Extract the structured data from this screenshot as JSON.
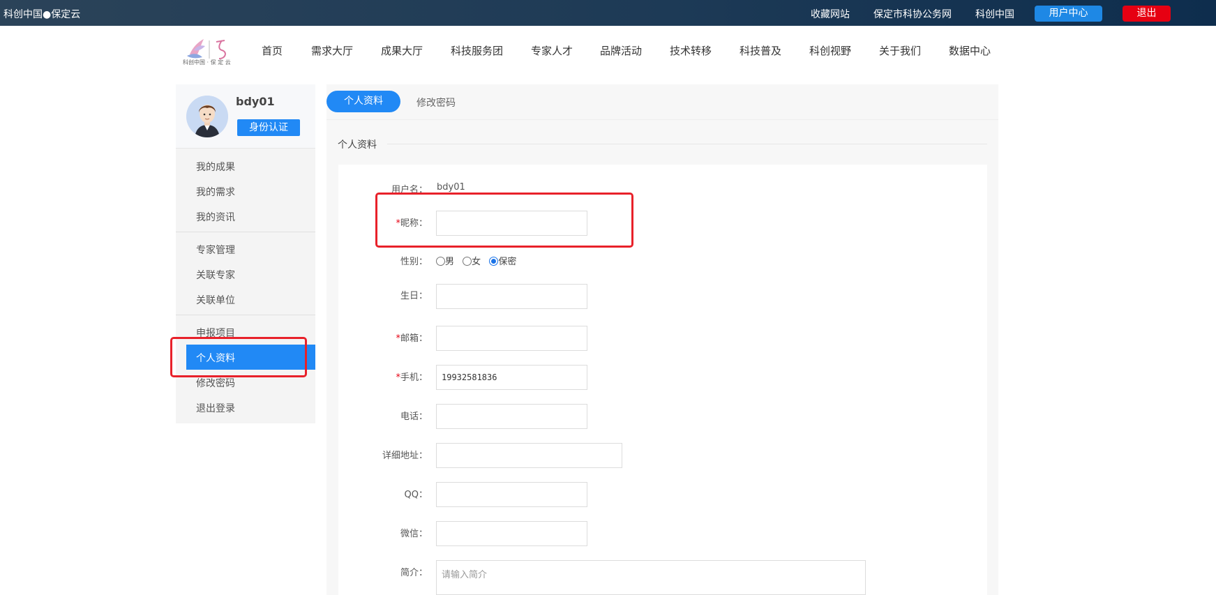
{
  "topbar": {
    "site_name": "科创中国●保定云",
    "links": [
      "收藏网站",
      "保定市科协公务网",
      "科创中国"
    ],
    "user_center": "用户中心",
    "logout": "退出"
  },
  "logo": {
    "caption": "科创中国 · 保 定 云"
  },
  "nav": [
    "首页",
    "需求大厅",
    "成果大厅",
    "科技服务团",
    "专家人才",
    "品牌活动",
    "技术转移",
    "科技普及",
    "科创视野",
    "关于我们",
    "数据中心"
  ],
  "sidebar": {
    "username": "bdy01",
    "verify_button": "身份认证",
    "groups": [
      [
        "我的成果",
        "我的需求",
        "我的资讯"
      ],
      [
        "专家管理",
        "关联专家",
        "关联单位"
      ],
      [
        "申报项目",
        "个人资料",
        "修改密码",
        "退出登录"
      ]
    ],
    "active": "个人资料"
  },
  "tabs": {
    "active": "个人资料",
    "other": "修改密码"
  },
  "section_title": "个人资料",
  "form": {
    "username_label": "用户名：",
    "username_value": "bdy01",
    "nickname_label": "昵称：",
    "nickname_value": "",
    "gender_label": "性别：",
    "gender_options": [
      "男",
      "女",
      "保密"
    ],
    "gender_selected": "保密",
    "birthday_label": "生日：",
    "birthday_value": "",
    "email_label": "邮箱：",
    "email_value": "",
    "mobile_label": "手机：",
    "mobile_value": "19932581836",
    "phone_label": "电话：",
    "phone_value": "",
    "address_label": "详细地址：",
    "address_value": "",
    "qq_label": "QQ：",
    "qq_value": "",
    "wechat_label": "微信：",
    "wechat_value": "",
    "intro_label": "简介：",
    "intro_placeholder": "请输入简介",
    "required_mark": "*"
  },
  "colors": {
    "accent": "#2189f5",
    "danger": "#e60012",
    "highlight": "#e8212a",
    "topbar": "#1d3a56"
  }
}
